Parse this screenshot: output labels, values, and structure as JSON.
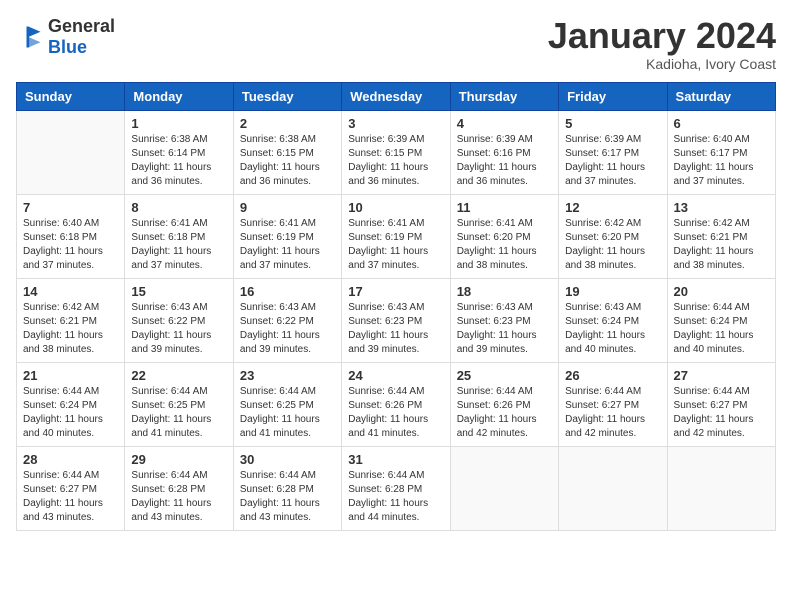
{
  "logo": {
    "general": "General",
    "blue": "Blue"
  },
  "title": "January 2024",
  "subtitle": "Kadioha, Ivory Coast",
  "days_header": [
    "Sunday",
    "Monday",
    "Tuesday",
    "Wednesday",
    "Thursday",
    "Friday",
    "Saturday"
  ],
  "weeks": [
    [
      {
        "date": "",
        "info": ""
      },
      {
        "date": "1",
        "info": "Sunrise: 6:38 AM\nSunset: 6:14 PM\nDaylight: 11 hours\nand 36 minutes."
      },
      {
        "date": "2",
        "info": "Sunrise: 6:38 AM\nSunset: 6:15 PM\nDaylight: 11 hours\nand 36 minutes."
      },
      {
        "date": "3",
        "info": "Sunrise: 6:39 AM\nSunset: 6:15 PM\nDaylight: 11 hours\nand 36 minutes."
      },
      {
        "date": "4",
        "info": "Sunrise: 6:39 AM\nSunset: 6:16 PM\nDaylight: 11 hours\nand 36 minutes."
      },
      {
        "date": "5",
        "info": "Sunrise: 6:39 AM\nSunset: 6:17 PM\nDaylight: 11 hours\nand 37 minutes."
      },
      {
        "date": "6",
        "info": "Sunrise: 6:40 AM\nSunset: 6:17 PM\nDaylight: 11 hours\nand 37 minutes."
      }
    ],
    [
      {
        "date": "7",
        "info": "Sunrise: 6:40 AM\nSunset: 6:18 PM\nDaylight: 11 hours\nand 37 minutes."
      },
      {
        "date": "8",
        "info": "Sunrise: 6:41 AM\nSunset: 6:18 PM\nDaylight: 11 hours\nand 37 minutes."
      },
      {
        "date": "9",
        "info": "Sunrise: 6:41 AM\nSunset: 6:19 PM\nDaylight: 11 hours\nand 37 minutes."
      },
      {
        "date": "10",
        "info": "Sunrise: 6:41 AM\nSunset: 6:19 PM\nDaylight: 11 hours\nand 37 minutes."
      },
      {
        "date": "11",
        "info": "Sunrise: 6:41 AM\nSunset: 6:20 PM\nDaylight: 11 hours\nand 38 minutes."
      },
      {
        "date": "12",
        "info": "Sunrise: 6:42 AM\nSunset: 6:20 PM\nDaylight: 11 hours\nand 38 minutes."
      },
      {
        "date": "13",
        "info": "Sunrise: 6:42 AM\nSunset: 6:21 PM\nDaylight: 11 hours\nand 38 minutes."
      }
    ],
    [
      {
        "date": "14",
        "info": "Sunrise: 6:42 AM\nSunset: 6:21 PM\nDaylight: 11 hours\nand 38 minutes."
      },
      {
        "date": "15",
        "info": "Sunrise: 6:43 AM\nSunset: 6:22 PM\nDaylight: 11 hours\nand 39 minutes."
      },
      {
        "date": "16",
        "info": "Sunrise: 6:43 AM\nSunset: 6:22 PM\nDaylight: 11 hours\nand 39 minutes."
      },
      {
        "date": "17",
        "info": "Sunrise: 6:43 AM\nSunset: 6:23 PM\nDaylight: 11 hours\nand 39 minutes."
      },
      {
        "date": "18",
        "info": "Sunrise: 6:43 AM\nSunset: 6:23 PM\nDaylight: 11 hours\nand 39 minutes."
      },
      {
        "date": "19",
        "info": "Sunrise: 6:43 AM\nSunset: 6:24 PM\nDaylight: 11 hours\nand 40 minutes."
      },
      {
        "date": "20",
        "info": "Sunrise: 6:44 AM\nSunset: 6:24 PM\nDaylight: 11 hours\nand 40 minutes."
      }
    ],
    [
      {
        "date": "21",
        "info": "Sunrise: 6:44 AM\nSunset: 6:24 PM\nDaylight: 11 hours\nand 40 minutes."
      },
      {
        "date": "22",
        "info": "Sunrise: 6:44 AM\nSunset: 6:25 PM\nDaylight: 11 hours\nand 41 minutes."
      },
      {
        "date": "23",
        "info": "Sunrise: 6:44 AM\nSunset: 6:25 PM\nDaylight: 11 hours\nand 41 minutes."
      },
      {
        "date": "24",
        "info": "Sunrise: 6:44 AM\nSunset: 6:26 PM\nDaylight: 11 hours\nand 41 minutes."
      },
      {
        "date": "25",
        "info": "Sunrise: 6:44 AM\nSunset: 6:26 PM\nDaylight: 11 hours\nand 42 minutes."
      },
      {
        "date": "26",
        "info": "Sunrise: 6:44 AM\nSunset: 6:27 PM\nDaylight: 11 hours\nand 42 minutes."
      },
      {
        "date": "27",
        "info": "Sunrise: 6:44 AM\nSunset: 6:27 PM\nDaylight: 11 hours\nand 42 minutes."
      }
    ],
    [
      {
        "date": "28",
        "info": "Sunrise: 6:44 AM\nSunset: 6:27 PM\nDaylight: 11 hours\nand 43 minutes."
      },
      {
        "date": "29",
        "info": "Sunrise: 6:44 AM\nSunset: 6:28 PM\nDaylight: 11 hours\nand 43 minutes."
      },
      {
        "date": "30",
        "info": "Sunrise: 6:44 AM\nSunset: 6:28 PM\nDaylight: 11 hours\nand 43 minutes."
      },
      {
        "date": "31",
        "info": "Sunrise: 6:44 AM\nSunset: 6:28 PM\nDaylight: 11 hours\nand 44 minutes."
      },
      {
        "date": "",
        "info": ""
      },
      {
        "date": "",
        "info": ""
      },
      {
        "date": "",
        "info": ""
      }
    ]
  ]
}
